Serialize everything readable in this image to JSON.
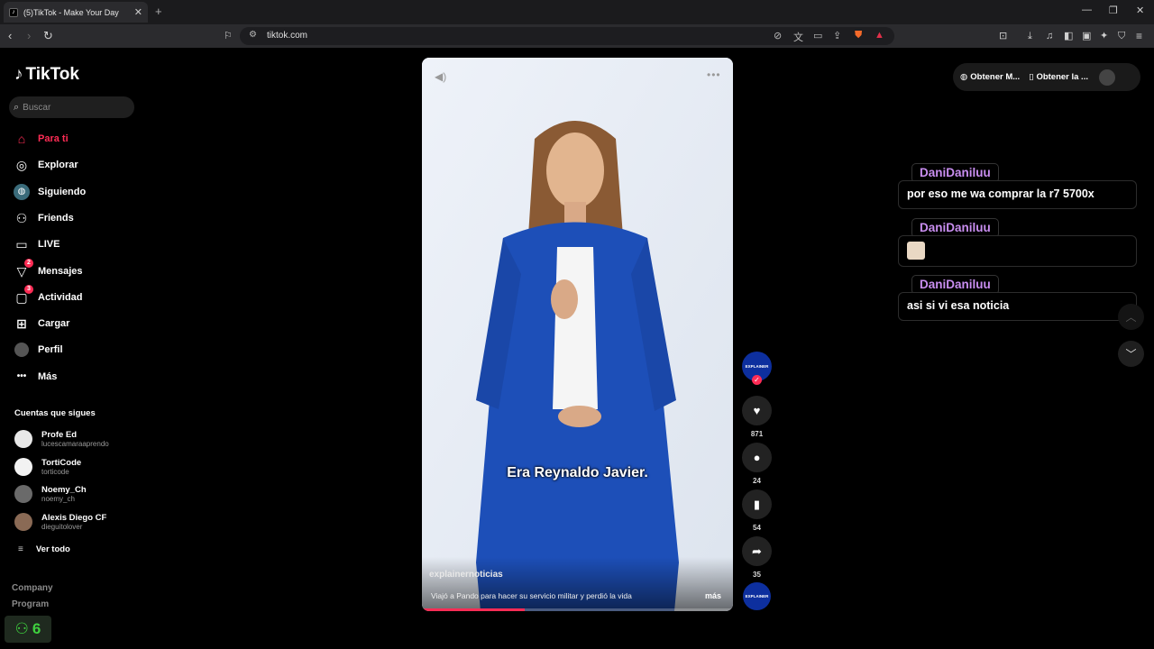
{
  "browser": {
    "tab_title": "(5)TikTok - Make Your Day",
    "url": "tiktok.com"
  },
  "sidebar": {
    "logo": "TikTok",
    "search_placeholder": "Buscar",
    "nav": [
      {
        "label": "Para ti",
        "icon": "home-icon",
        "active": true
      },
      {
        "label": "Explorar",
        "icon": "compass-icon"
      },
      {
        "label": "Siguiendo",
        "icon": "following-icon"
      },
      {
        "label": "Friends",
        "icon": "friends-icon"
      },
      {
        "label": "LIVE",
        "icon": "live-icon"
      },
      {
        "label": "Mensajes",
        "icon": "messages-icon",
        "badge": "2"
      },
      {
        "label": "Actividad",
        "icon": "activity-icon",
        "badge": "3"
      },
      {
        "label": "Cargar",
        "icon": "upload-icon"
      },
      {
        "label": "Perfil",
        "icon": "profile-icon"
      },
      {
        "label": "Más",
        "icon": "more-icon"
      }
    ],
    "following_title": "Cuentas que sigues",
    "accounts": [
      {
        "name": "Profe Ed",
        "handle": "lucescamaraaprendo"
      },
      {
        "name": "TortiCode",
        "handle": "torticode"
      },
      {
        "name": "Noemy_Ch",
        "handle": "noemy_ch"
      },
      {
        "name": "Alexis Diego CF",
        "handle": "dieguitolover"
      }
    ],
    "see_all": "Ver todo",
    "footer": [
      "Company",
      "Program"
    ]
  },
  "overlay": {
    "viewers": "6"
  },
  "video": {
    "subtitle": "Era Reynaldo Javier.",
    "author": "explainernoticias",
    "description": "Viajó a Pando para hacer su servicio militar y perdió la vida",
    "more": "más",
    "progress": 0.33
  },
  "actions": {
    "avatar_label": "EXPLAINER",
    "likes": "871",
    "comments": "24",
    "saves": "54",
    "shares": "35"
  },
  "top_right": {
    "get_app": "Obtener M...",
    "get_desktop": "Obtener la ..."
  },
  "chat": [
    {
      "user": "DaniDaniluu",
      "message": "por eso me wa comprar la r7 5700x"
    },
    {
      "user": "DaniDaniluu",
      "message": ""
    },
    {
      "user": "DaniDaniluu",
      "message": "asi si vi esa noticia"
    }
  ],
  "colors": {
    "accent": "#fe2c55",
    "chat_name": "#c98ef0",
    "viewer_green": "#3fd13f"
  }
}
